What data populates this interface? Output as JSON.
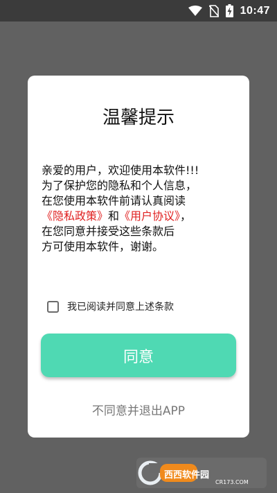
{
  "status_bar": {
    "time": "10:47",
    "icons": [
      "wifi-icon",
      "no-sim-icon",
      "battery-charging-icon"
    ]
  },
  "dialog": {
    "title": "温馨提示",
    "body_lines": [
      "亲爱的用户，欢迎使用本软件!!!",
      "为了保护您的隐私和个人信息，",
      "在您使用本软件前请认真阅读"
    ],
    "privacy_link": "《隐私政策》",
    "and_text": "和",
    "user_agreement_link": "《用户协议》",
    "comma": "，",
    "body_lines_after": [
      "在您同意并接受这些条款后",
      "方可使用本软件，谢谢。"
    ],
    "checkbox_label": "我已阅读并同意上述条款",
    "checkbox_checked": false,
    "agree_button": "同意",
    "exit_link": "不同意并退出APP"
  },
  "watermark": {
    "brand": "西西软件园",
    "url": "CR173.COM"
  },
  "colors": {
    "accent": "#4fd9b3",
    "link_red": "#e02020",
    "overlay": "#616161"
  }
}
